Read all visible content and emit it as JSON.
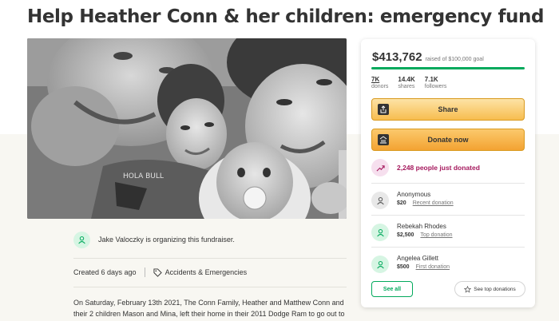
{
  "page": {
    "title": "Help Heather Conn & her children: emergency fund"
  },
  "hero": {
    "onesie_text": "HOLA BULL"
  },
  "organizer": {
    "text": "Jake Valoczky is organizing this fundraiser."
  },
  "meta": {
    "created": "Created 6 days ago",
    "category": "Accidents & Emergencies"
  },
  "story": {
    "text": "On Saturday, February 13th 2021, The Conn Family, Heather and Matthew Conn and their 2 children Mason and Mina, left their home in their 2011 Dodge Ram to go out to"
  },
  "donation_card": {
    "raised_amount": "$413,762",
    "goal_text": "raised of $100,000 goal",
    "progress_fraction": 1.0,
    "stats": [
      {
        "value": "7K",
        "label": "donors"
      },
      {
        "value": "14.4K",
        "label": "shares"
      },
      {
        "value": "7.1K",
        "label": "followers"
      }
    ],
    "share_label": "Share",
    "donate_label": "Donate now",
    "trending_text": "2,248 people just donated",
    "donations": [
      {
        "name": "Anonymous",
        "amount": "$20",
        "tag": "Recent donation"
      },
      {
        "name": "Rebekah Rhodes",
        "amount": "$2,500",
        "tag": "Top donation"
      },
      {
        "name": "Angelea Gillett",
        "amount": "$500",
        "tag": "First donation"
      }
    ],
    "see_all_label": "See all",
    "see_top_label": "See top donations"
  },
  "colors": {
    "brand_green": "#02a95c",
    "button_amber": "#f7bd4f",
    "trending_magenta": "#a5185d"
  }
}
